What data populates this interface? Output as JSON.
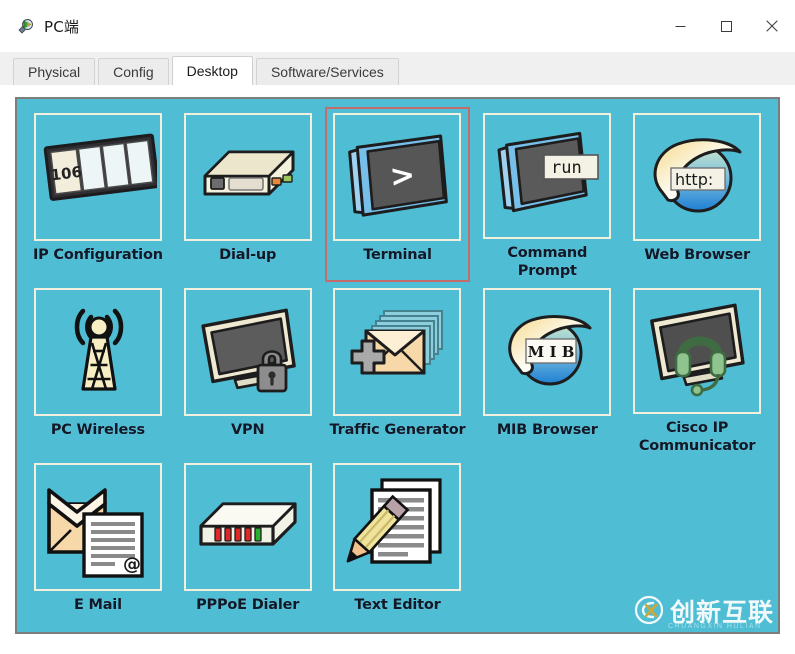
{
  "window": {
    "title": "PC端",
    "icon": "packet-tracer-icon",
    "controls": {
      "minimize": "−",
      "maximize": "□",
      "close": "✕"
    }
  },
  "tabs": [
    {
      "label": "Physical",
      "active": false
    },
    {
      "label": "Config",
      "active": false
    },
    {
      "label": "Desktop",
      "active": true
    },
    {
      "label": "Software/Services",
      "active": false
    }
  ],
  "desktop": {
    "background_color": "#4fbdd4",
    "selection_color": "#c46b6b",
    "items": [
      {
        "label": "IP Configuration",
        "icon": "ip-configuration-icon",
        "badge": "106",
        "selected": false
      },
      {
        "label": "Dial-up",
        "icon": "dial-up-icon",
        "selected": false
      },
      {
        "label": "Terminal",
        "icon": "terminal-icon",
        "badge": ">",
        "selected": true
      },
      {
        "label": "Command Prompt",
        "icon": "command-prompt-icon",
        "badge": "run",
        "selected": false
      },
      {
        "label": "Web Browser",
        "icon": "web-browser-icon",
        "badge": "http:",
        "selected": false
      },
      {
        "label": "PC Wireless",
        "icon": "pc-wireless-icon",
        "selected": false
      },
      {
        "label": "VPN",
        "icon": "vpn-icon",
        "selected": false
      },
      {
        "label": "Traffic Generator",
        "icon": "traffic-generator-icon",
        "selected": false
      },
      {
        "label": "MIB Browser",
        "icon": "mib-browser-icon",
        "badge": "M I B",
        "selected": false
      },
      {
        "label": "Cisco IP Communicator",
        "icon": "cisco-ip-communicator-icon",
        "selected": false
      },
      {
        "label": "E Mail",
        "icon": "email-icon",
        "badge": "@",
        "selected": false
      },
      {
        "label": "PPPoE Dialer",
        "icon": "pppoe-dialer-icon",
        "selected": false
      },
      {
        "label": "Text Editor",
        "icon": "text-editor-icon",
        "selected": false
      }
    ]
  },
  "watermark": {
    "text": "创新互联",
    "sub": "CHUANGXIN HULIAN",
    "logo": "cx-logo-icon"
  }
}
